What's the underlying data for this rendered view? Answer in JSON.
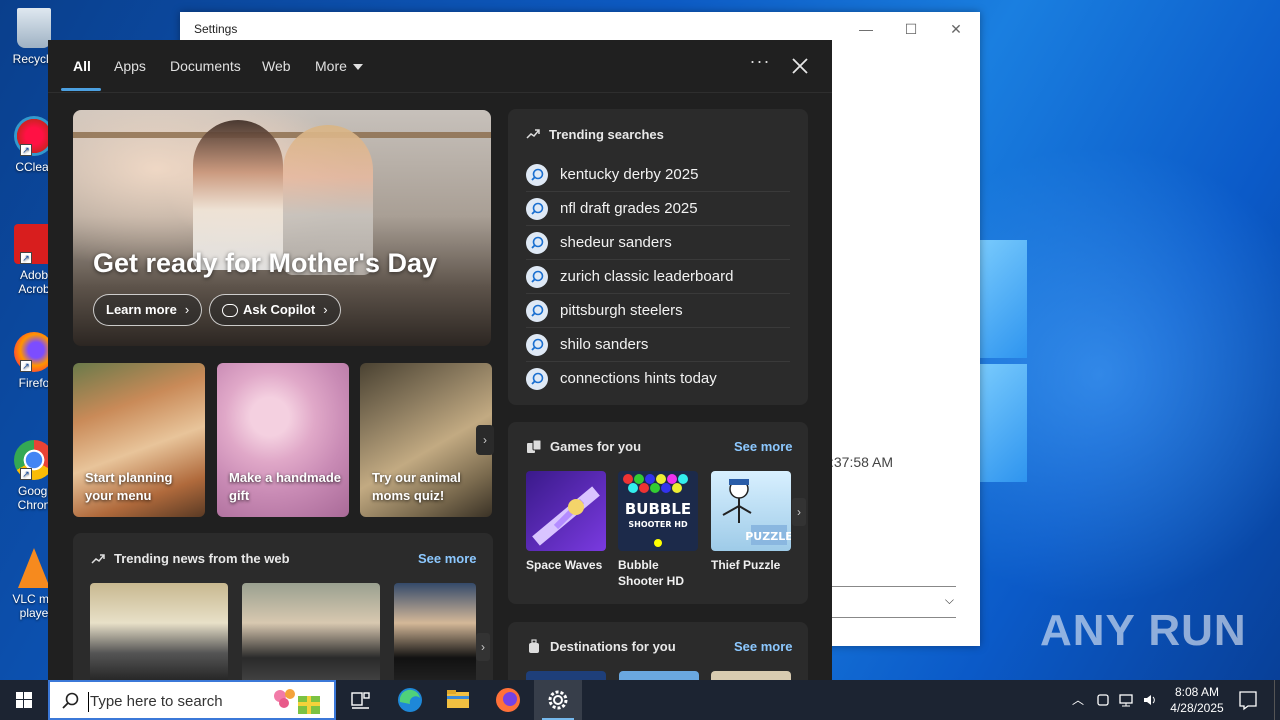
{
  "desktop": {
    "icons": [
      {
        "label": "Recycle",
        "icon": "recycle-bin-icon"
      },
      {
        "label": "CClear",
        "icon": "ccleaner-icon"
      },
      {
        "label": "Adob Acrob",
        "icon": "adobe-acrobat-icon"
      },
      {
        "label": "Firefo",
        "icon": "firefox-icon"
      },
      {
        "label": "Googl Chron",
        "icon": "chrome-icon"
      },
      {
        "label": "VLC me playe",
        "icon": "vlc-icon"
      }
    ],
    "watermark": "ANY RUN"
  },
  "settings_window": {
    "title": "Settings",
    "minimize": "—",
    "maximize": "☐",
    "close": "✕",
    "time_text": ":37:58 AM",
    "field_chevron": "⌵"
  },
  "search": {
    "tabs": [
      {
        "label": "All",
        "active": true
      },
      {
        "label": "Apps"
      },
      {
        "label": "Documents"
      },
      {
        "label": "Web"
      },
      {
        "label": "More"
      }
    ],
    "options_label": "···",
    "hero": {
      "title": "Get ready for Mother's Day",
      "learn_more": "Learn more",
      "ask_copilot": "Ask Copilot"
    },
    "cards": [
      {
        "label": "Start planning your menu"
      },
      {
        "label": "Make a handmade gift"
      },
      {
        "label": "Try our animal moms quiz!"
      }
    ],
    "news": {
      "title": "Trending news from the web",
      "see_more": "See more"
    },
    "trending": {
      "title": "Trending searches",
      "items": [
        "kentucky derby 2025",
        "nfl draft grades 2025",
        "shedeur sanders",
        "zurich classic leaderboard",
        "pittsburgh steelers",
        "shilo sanders",
        "connections hints today"
      ]
    },
    "games": {
      "title": "Games for you",
      "see_more": "See more",
      "items": [
        {
          "label": "Space Waves"
        },
        {
          "label": "Bubble Shooter HD"
        },
        {
          "label": "Thief Puzzle"
        }
      ],
      "bubble_text": "BUBBLE",
      "shooter_text": "SHOOTER HD",
      "thief_text": "PUZZLE"
    },
    "destinations": {
      "title": "Destinations for you",
      "see_more": "See more"
    }
  },
  "taskbar": {
    "search_placeholder": "Type here to search",
    "time": "8:08 AM",
    "date": "4/28/2025"
  }
}
